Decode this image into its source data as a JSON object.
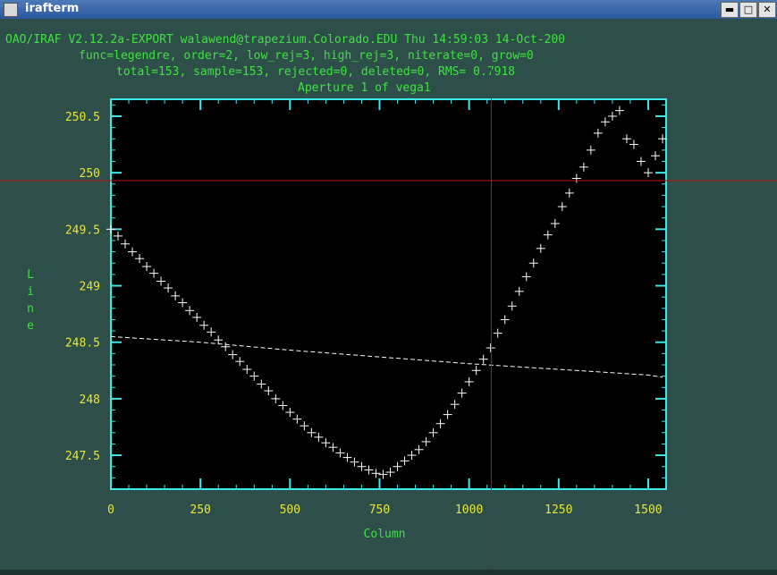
{
  "window": {
    "title": "irafterm",
    "buttons": [
      "▬",
      "□",
      "✕"
    ]
  },
  "header": {
    "line1": "OAO/IRAF V2.12.2a-EXPORT walawend@trapezium.Colorado.EDU Thu 14:59:03 14-Oct-200",
    "line2": "func=legendre, order=2, low_rej=3, high_rej=3, niterate=0, grow=0",
    "line3": "total=153, sample=153, rejected=0, deleted=0, RMS= 0.7918",
    "line4": "Aperture 1 of vega1"
  },
  "colors": {
    "background": "#000000",
    "frame": "#3de8e8",
    "tick_labels": "#e6e63c",
    "text": "#3fe23f",
    "points": "#ffffff",
    "cursor": "#c01010"
  },
  "chart_data": {
    "type": "scatter",
    "xlabel": "Column",
    "ylabel": "Line",
    "xlim": [
      0,
      1550
    ],
    "ylim": [
      247.2,
      250.65
    ],
    "xticks": [
      0,
      250,
      500,
      750,
      1000,
      1250,
      1500
    ],
    "xtick_labels": [
      "0",
      "250",
      "500",
      "750",
      "1000",
      "1250",
      "1500"
    ],
    "yticks": [
      247.5,
      248,
      248.5,
      249,
      249.5,
      250,
      250.5
    ],
    "ytick_labels": [
      "247.5",
      "248",
      "248.5",
      "249",
      "249.5",
      "250",
      "250.5"
    ],
    "grid": false,
    "marker": "+",
    "cursor": {
      "x": 1062,
      "y": 249.93
    },
    "series": [
      {
        "style": "points",
        "x": [
          0,
          20,
          40,
          60,
          80,
          100,
          120,
          140,
          160,
          180,
          200,
          220,
          240,
          260,
          280,
          300,
          320,
          340,
          360,
          380,
          400,
          420,
          440,
          460,
          480,
          500,
          520,
          540,
          560,
          580,
          600,
          620,
          640,
          660,
          680,
          700,
          720,
          740,
          760,
          780,
          800,
          820,
          840,
          860,
          880,
          900,
          920,
          940,
          960,
          980,
          1000,
          1020,
          1040,
          1060,
          1080,
          1100,
          1120,
          1140,
          1160,
          1180,
          1200,
          1220,
          1240,
          1260,
          1280,
          1300,
          1320,
          1340,
          1360,
          1380,
          1400,
          1420,
          1440,
          1460,
          1480,
          1500,
          1520,
          1540
        ],
        "y": [
          249.5,
          249.44,
          249.37,
          249.3,
          249.24,
          249.17,
          249.11,
          249.04,
          248.98,
          248.91,
          248.85,
          248.78,
          248.72,
          248.65,
          248.59,
          248.52,
          248.46,
          248.39,
          248.33,
          248.26,
          248.2,
          248.13,
          248.07,
          248.0,
          247.94,
          247.88,
          247.82,
          247.76,
          247.7,
          247.66,
          247.61,
          247.57,
          247.52,
          247.48,
          247.44,
          247.4,
          247.37,
          247.34,
          247.33,
          247.35,
          247.4,
          247.45,
          247.5,
          247.55,
          247.62,
          247.7,
          247.78,
          247.86,
          247.95,
          248.05,
          248.15,
          248.25,
          248.35,
          248.45,
          248.58,
          248.7,
          248.82,
          248.95,
          249.08,
          249.2,
          249.33,
          249.45,
          249.55,
          249.7,
          249.82,
          249.95,
          250.05,
          250.2,
          250.35,
          250.45,
          250.5,
          250.55,
          250.3,
          250.25,
          250.1,
          250.0,
          250.15,
          250.3
        ],
        "note_points": "approximate readings"
      },
      {
        "style": "dashed-line",
        "x": [
          0,
          250,
          500,
          750,
          1000,
          1250,
          1500,
          1540
        ],
        "y": [
          248.55,
          248.5,
          248.43,
          248.37,
          248.31,
          248.26,
          248.21,
          248.19
        ]
      }
    ]
  }
}
